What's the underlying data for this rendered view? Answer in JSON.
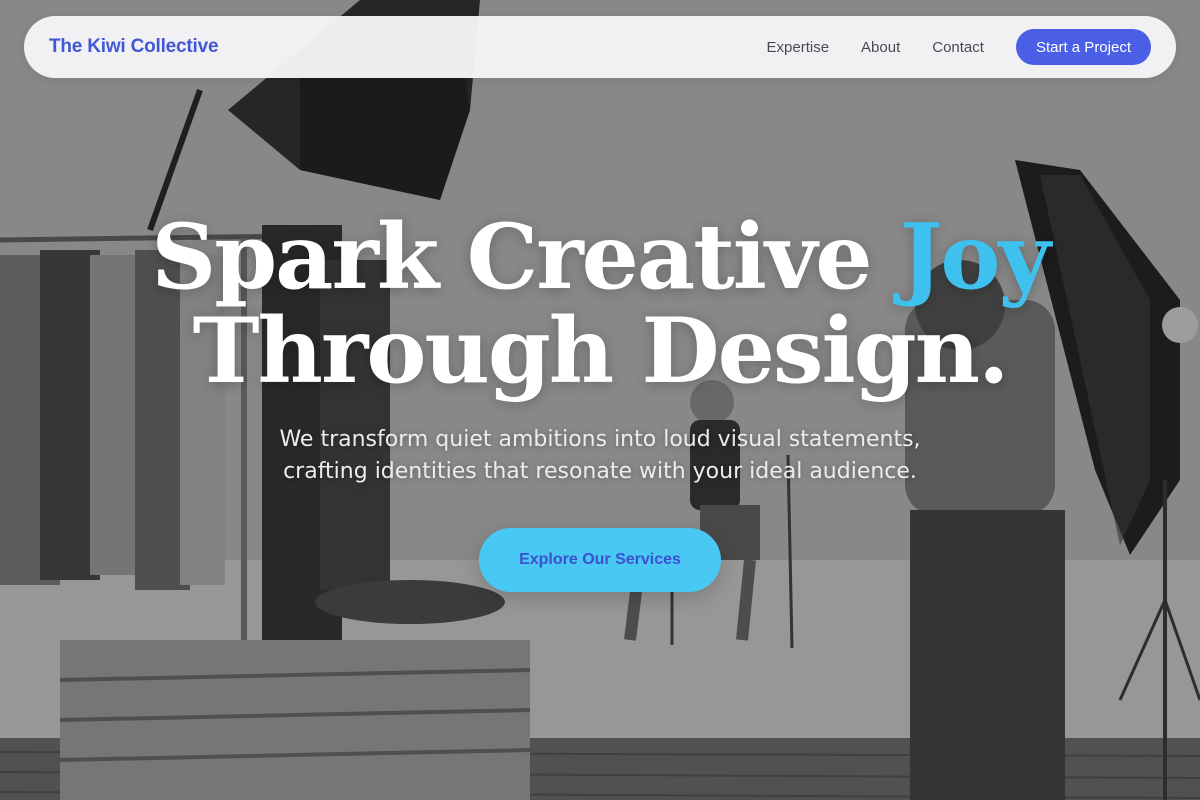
{
  "nav": {
    "brand": "The Kiwi Collective",
    "links": [
      "Expertise",
      "About",
      "Contact"
    ],
    "cta": "Start a Project"
  },
  "hero": {
    "title_part1": "Spark Creative ",
    "title_accent": "Joy",
    "title_line2": "Through Design.",
    "subtitle_line1": "We transform quiet ambitions into loud visual statements,",
    "subtitle_line2": "crafting identities that resonate with your ideal audience.",
    "cta": "Explore Our Services"
  },
  "colors": {
    "brand": "#4257d6",
    "primary_button": "#4a5fe6",
    "accent": "#3ec1ef",
    "cta_button": "#48c8f2"
  },
  "background": {
    "description_icon": "photo-studio-background"
  }
}
